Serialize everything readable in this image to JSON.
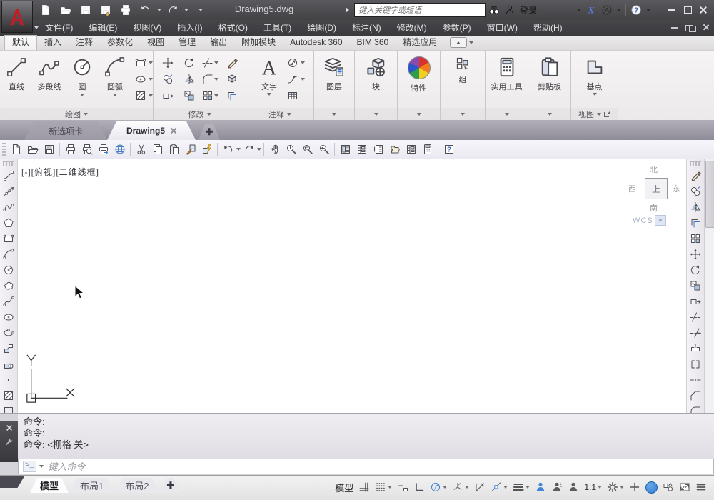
{
  "titlebar": {
    "title": "Drawing5.dwg",
    "search_placeholder": "键入关键字或短语",
    "login_label": "登录"
  },
  "menubar": {
    "items": [
      "文件(F)",
      "编辑(E)",
      "视图(V)",
      "插入(I)",
      "格式(O)",
      "工具(T)",
      "绘图(D)",
      "标注(N)",
      "修改(M)",
      "参数(P)",
      "窗口(W)",
      "帮助(H)"
    ]
  },
  "ribbon": {
    "tabs": [
      "默认",
      "插入",
      "注释",
      "参数化",
      "视图",
      "管理",
      "输出",
      "附加模块",
      "Autodesk 360",
      "BIM 360",
      "精选应用"
    ],
    "active_tab": "默认",
    "panels": {
      "draw": {
        "title": "绘图",
        "line": "直线",
        "polyline": "多段线",
        "circle": "圆",
        "arc": "圆弧"
      },
      "modify": {
        "title": "修改"
      },
      "annotate": {
        "title": "注释",
        "text": "文字"
      },
      "layers": {
        "label": "图层"
      },
      "block": {
        "label": "块"
      },
      "properties": {
        "label": "特性"
      },
      "group": {
        "label": "组"
      },
      "utilities": {
        "label": "实用工具"
      },
      "clipboard": {
        "label": "剪贴板"
      },
      "view": {
        "title": "视图",
        "base": "基点"
      }
    }
  },
  "file_tabs": {
    "new_tab": "新选项卡",
    "drawing_tab": "Drawing5"
  },
  "viewport": {
    "label": "[-][俯视][二维线框]",
    "viewcube": {
      "north": "北",
      "south": "南",
      "east": "东",
      "west": "西",
      "top": "上",
      "wcs": "WCS"
    }
  },
  "command": {
    "history": [
      "命令:",
      "命令:",
      "命令:  <栅格 关>"
    ],
    "input_placeholder": "键入命令"
  },
  "statusbar": {
    "layout_tabs": [
      "模型",
      "布局1",
      "布局2"
    ],
    "model_label": "模型",
    "annotation_scale": "1:1"
  },
  "colors": {
    "accent_red": "#b01e23",
    "blue": "#3a72c8",
    "status_blue": "#2e7ed3"
  }
}
